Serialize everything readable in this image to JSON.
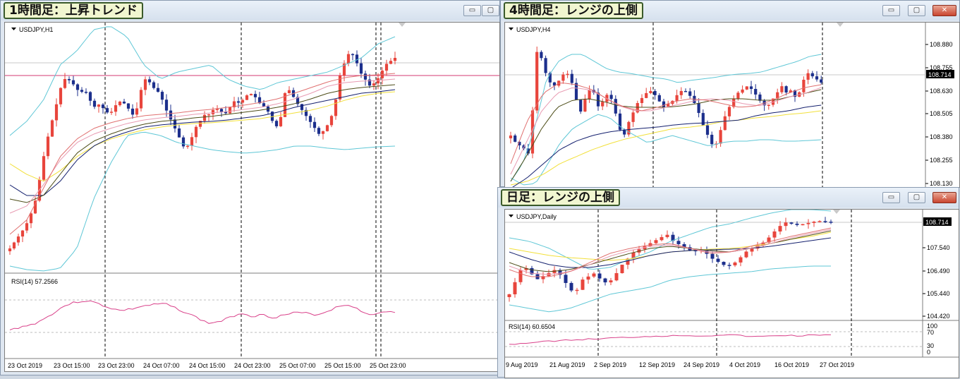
{
  "windows": [
    {
      "title": "1時間足：上昇トレンド",
      "symbol": "USDJPY,H1",
      "rsi": "RSI(14) 57.2566",
      "time_labels": [
        "23 Oct 2019",
        "23 Oct 15:00",
        "23 Oct 23:00",
        "24 Oct 07:00",
        "24 Oct 15:00",
        "24 Oct 23:00",
        "25 Oct 07:00",
        "25 Oct 15:00",
        "25 Oct 23:00"
      ]
    },
    {
      "title": "4時間足：レンジの上側",
      "symbol": "USDJPY,H4",
      "price_labels": [
        "108.880",
        "108.755",
        "108.714",
        "108.630",
        "108.505",
        "108.380",
        "108.255",
        "108.130"
      ],
      "current_price": "108.714"
    },
    {
      "title": "日足：レンジの上側",
      "symbol": "USDJPY,Daily",
      "rsi": "RSI(14) 60.6504",
      "price_labels": [
        "108.714",
        "107.540",
        "106.490",
        "105.440",
        "104.420"
      ],
      "rsi_levels": [
        "100",
        "70",
        "30",
        "0"
      ],
      "time_labels": [
        "9 Aug 2019",
        "21 Aug 2019",
        "2 Sep 2019",
        "12 Sep 2019",
        "24 Sep 2019",
        "4 Oct 2019",
        "16 Oct 2019",
        "27 Oct 2019"
      ]
    }
  ],
  "buttons": {
    "minimize": "▭",
    "maximize": "▢",
    "close": "✕"
  },
  "colors": {
    "bull": "#e8453c",
    "bear": "#1c2f8c",
    "bollinger": "#5fc7d6",
    "rsi_line": "#d9418a",
    "price_line": "#d33b73",
    "ma_yellow": "#f2e03a",
    "ma_navy": "#14206e",
    "ma_olive": "#4d4d18",
    "ma_pink": "#e89bb2",
    "ma_red": "#e07070"
  }
}
